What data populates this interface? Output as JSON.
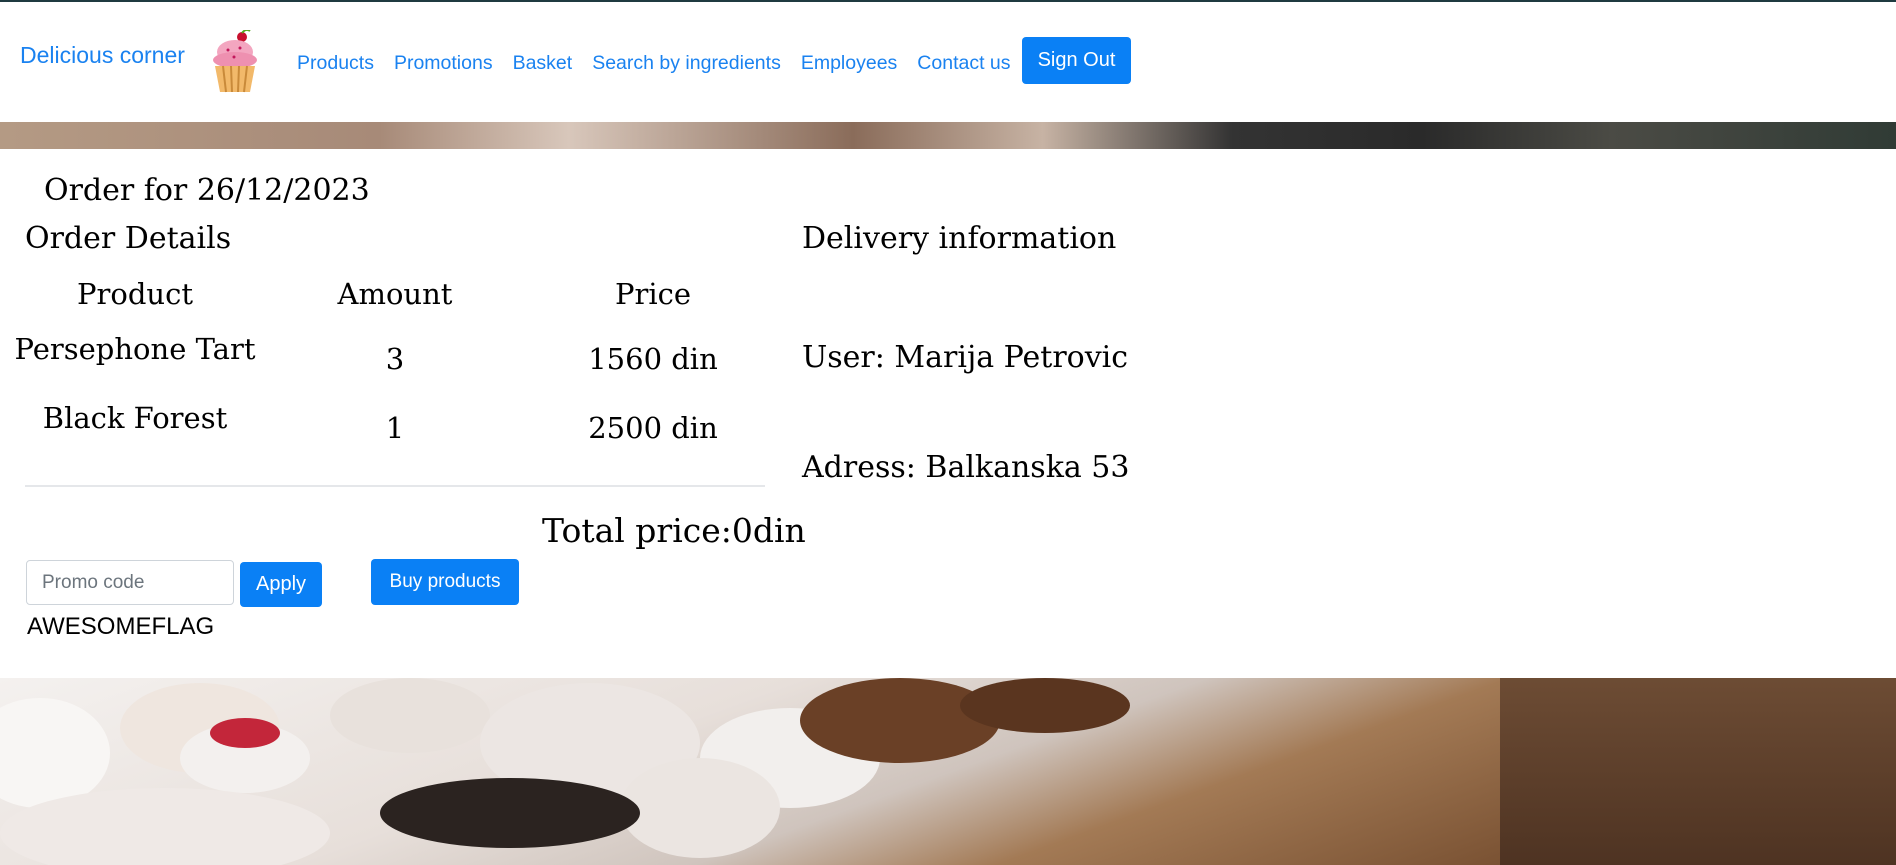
{
  "brand": {
    "name": "Delicious corner"
  },
  "nav": {
    "items": [
      "Products",
      "Promotions",
      "Basket",
      "Search by ingredients",
      "Employees",
      "Contact us"
    ],
    "signout_label": "Sign Out"
  },
  "order": {
    "title": "Order for 26/12/2023",
    "details_title": "Order Details",
    "columns": [
      "Product",
      "Amount",
      "Price"
    ],
    "rows": [
      {
        "product": "Persephone Tart",
        "amount": "3",
        "price": "1560 din"
      },
      {
        "product": "Black Forest",
        "amount": "1",
        "price": "2500 din"
      }
    ],
    "total_label": "Total price:0din"
  },
  "promo": {
    "placeholder": "Promo code",
    "value": "",
    "apply_label": "Apply",
    "code_text": "AWESOMEFLAG"
  },
  "buy_label": "Buy products",
  "delivery": {
    "title": "Delivery information",
    "user": "User: Marija Petrovic",
    "address": "Adress: Balkanska 53"
  },
  "colors": {
    "accent": "#0a80f5",
    "link": "#1a82f0"
  },
  "icons": {
    "logo": "cupcake-icon"
  }
}
